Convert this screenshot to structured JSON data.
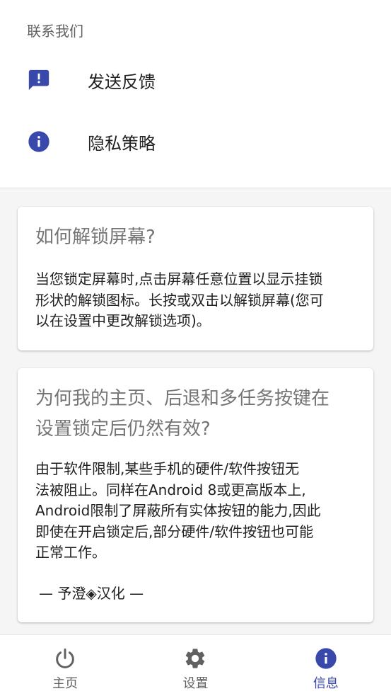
{
  "colors": {
    "accent": "#3949ab",
    "icon_gray": "#616161",
    "title_gray": "#757575",
    "text": "#212121"
  },
  "contact": {
    "header": "联系我们",
    "items": [
      {
        "label": "发送反馈",
        "icon": "feedback-icon"
      },
      {
        "label": "隐私策略",
        "icon": "info-icon"
      }
    ]
  },
  "cards": [
    {
      "title": "如何解锁屏幕?",
      "body_lines": [
        "当您锁定屏幕时,点击屏幕任意位置以显示挂锁",
        "形状的解锁图标。长按或双击以解锁屏幕(您可",
        "以在设置中更改解锁选项)。"
      ]
    },
    {
      "title_lines": [
        "为何我的主页、后退和多任务按键在",
        "设置锁定后仍然有效?"
      ],
      "body_lines": [
        "由于软件限制,某些手机的硬件/软件按钮无",
        "法被阻止。同样在Android 8或更高版本上,",
        "Android限制了屏蔽所有实体按钮的能力,因此",
        "即使在开启锁定后,部分硬件/软件按钮也可能",
        "正常工作。"
      ],
      "signature": "— 予澄◈汉化 —"
    }
  ],
  "bottom_nav": {
    "items": [
      {
        "label": "主页",
        "icon": "power-icon",
        "active": false
      },
      {
        "label": "设置",
        "icon": "gear-icon",
        "active": false
      },
      {
        "label": "信息",
        "icon": "info-icon",
        "active": true
      }
    ]
  }
}
